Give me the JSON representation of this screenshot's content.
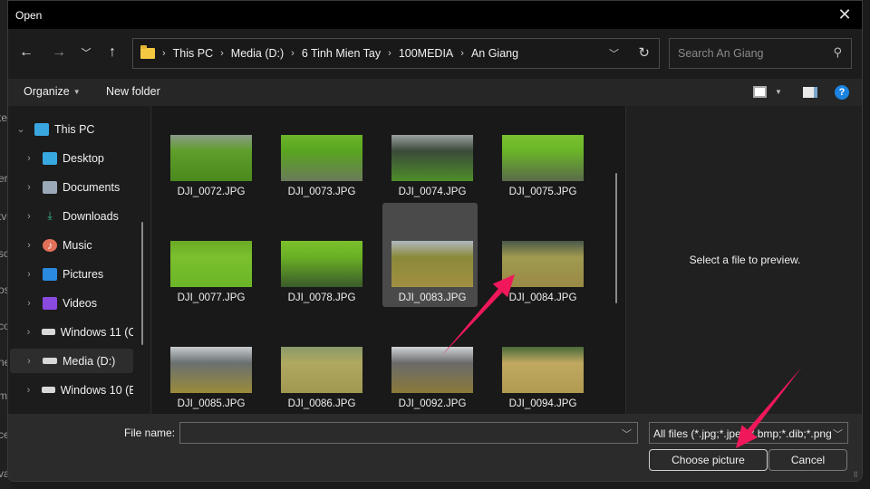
{
  "window": {
    "title": "Open"
  },
  "nav": {
    "back_icon": "arrow-left-icon",
    "forward_icon": "arrow-right-icon",
    "recent_icon": "chevron-down-icon",
    "up_icon": "arrow-up-icon"
  },
  "address": {
    "breadcrumbs": [
      "This PC",
      "Media (D:)",
      "6 Tinh Mien Tay",
      "100MEDIA",
      "An Giang"
    ]
  },
  "search": {
    "placeholder": "Search An Giang",
    "value": ""
  },
  "toolbar": {
    "organize_label": "Organize",
    "new_folder_label": "New folder"
  },
  "sidebar": {
    "items": [
      {
        "label": "This PC",
        "icon": "monitor-icon",
        "expanded": true
      },
      {
        "label": "Desktop",
        "icon": "desktop-icon"
      },
      {
        "label": "Documents",
        "icon": "documents-icon"
      },
      {
        "label": "Downloads",
        "icon": "download-icon"
      },
      {
        "label": "Music",
        "icon": "music-icon"
      },
      {
        "label": "Pictures",
        "icon": "pictures-icon"
      },
      {
        "label": "Videos",
        "icon": "videos-icon"
      },
      {
        "label": "Windows 11 (C:",
        "icon": "drive-windows-icon"
      },
      {
        "label": "Media (D:)",
        "icon": "drive-icon",
        "selected": true
      },
      {
        "label": "Windows 10 (E:",
        "icon": "drive-icon"
      }
    ]
  },
  "files": [
    {
      "name": "DJI_0072.JPG",
      "colors": [
        "#8a9a8a",
        "#5e9e2a",
        "#4a8a1e"
      ]
    },
    {
      "name": "DJI_0073.JPG",
      "colors": [
        "#6bb52a",
        "#5aa520",
        "#6a7a5a"
      ]
    },
    {
      "name": "DJI_0074.JPG",
      "colors": [
        "#9aa0a0",
        "#3a4a3a",
        "#4e8e2a"
      ]
    },
    {
      "name": "DJI_0075.JPG",
      "colors": [
        "#7ac030",
        "#6ab528",
        "#5a6a4a"
      ]
    },
    {
      "name": "DJI_0077.JPG",
      "colors": [
        "#6aaa25",
        "#7bc02e",
        "#6ab528"
      ]
    },
    {
      "name": "DJI_0078.JPG",
      "colors": [
        "#7ac02c",
        "#6ab025",
        "#3a5a2a"
      ]
    },
    {
      "name": "DJI_0083.JPG",
      "colors": [
        "#b0b8c0",
        "#8a8a3a",
        "#a09040"
      ],
      "selected": true
    },
    {
      "name": "DJI_0084.JPG",
      "colors": [
        "#4a5a4a",
        "#a09a50",
        "#9a8a45"
      ]
    },
    {
      "name": "DJI_0085.JPG",
      "colors": [
        "#c8ccd0",
        "#6a7070",
        "#9a8a3a"
      ]
    },
    {
      "name": "DJI_0086.JPG",
      "colors": [
        "#8a9a6a",
        "#b0a860",
        "#a09850"
      ]
    },
    {
      "name": "DJI_0092.JPG",
      "colors": [
        "#d0d4d8",
        "#6a6a6a",
        "#8a7a3a"
      ]
    },
    {
      "name": "DJI_0094.JPG",
      "colors": [
        "#4a6a3a",
        "#c0a860",
        "#b09a50"
      ]
    }
  ],
  "preview": {
    "message": "Select a file to preview."
  },
  "footer": {
    "file_name_label": "File name:",
    "file_name_value": "",
    "filter_value": "All files (*.jpg;*.jpeg;*.bmp;*.dib;*.png",
    "choose_label": "Choose picture",
    "cancel_label": "Cancel"
  },
  "annotation": {
    "arrow_color": "#f0185a"
  },
  "background_fragments": [
    "te",
    "er",
    "tv",
    "sc",
    "os",
    "co",
    "ne",
    "m",
    "ce",
    "va"
  ]
}
